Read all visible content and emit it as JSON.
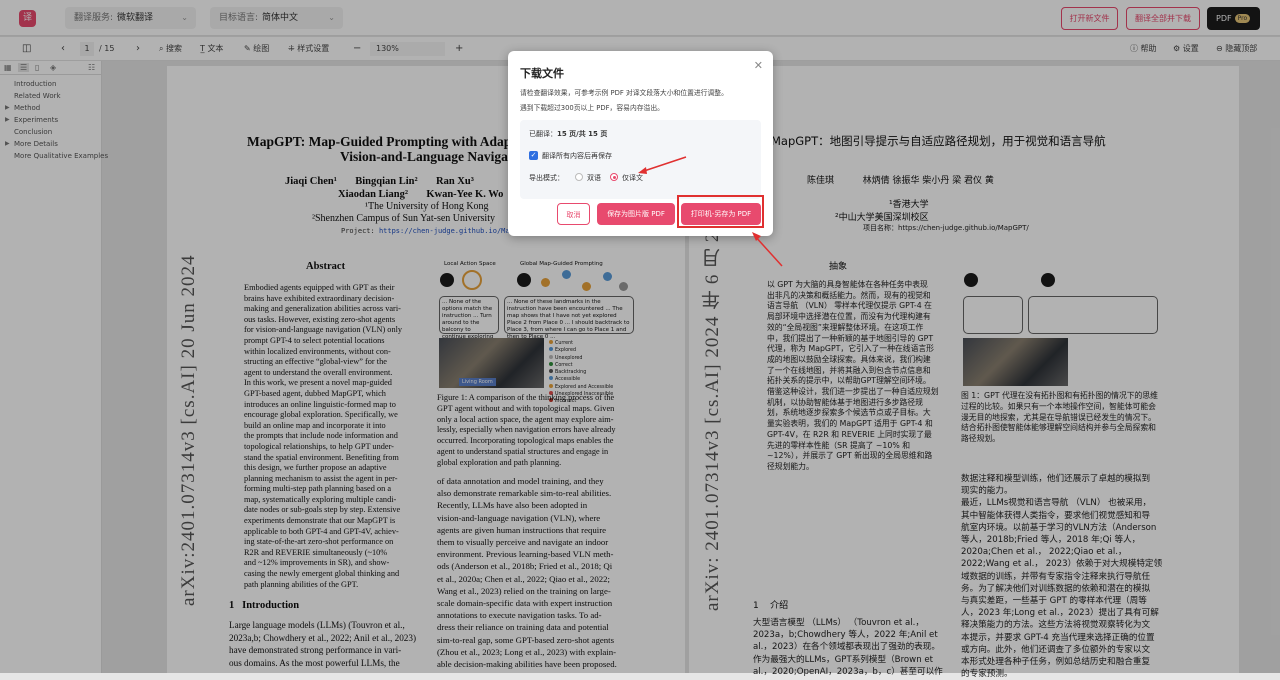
{
  "app": {
    "logo_text": "译"
  },
  "header": {
    "service_label": "翻译服务:",
    "service_value": "微软翻译",
    "target_label": "目标语言:",
    "target_value": "简体中文",
    "open_new": "打开新文件",
    "translate_all": "翻译全部并下载",
    "pdf_label": "PDF",
    "pro_badge": "Pro"
  },
  "toolbar": {
    "page_current": "1",
    "page_total": "/ 15",
    "search": "搜索",
    "text": "文本",
    "draw": "绘图",
    "style": "样式设置",
    "zoom": "130%",
    "help": "帮助",
    "settings": "设置",
    "hide_top": "隐藏顶部"
  },
  "outline": [
    "Introduction",
    "Related Work",
    "Method",
    "Experiments",
    "Conclusion",
    "More Details",
    "More Qualitative Examples"
  ],
  "paper": {
    "title1": "MapGPT: Map-Guided Prompting with Adaptiv",
    "title2": "Vision-and-Language Navigatio",
    "authors1": "Jiaqi Chen¹       Bingqian Lin²       Ran Xu³",
    "authors2": "Xiaodan Liang²       Kwan-Yee K. Wo",
    "affil1": "¹The University of Hong Kong",
    "affil2": "²Shenzhen Campus of Sun Yat-sen University",
    "project_label": "Project:",
    "project_url": "https://chen-judge.github.io/MapG",
    "arxiv": "arXiv:2401.07314v3  [cs.AI]  20 Jun 2024",
    "abstract_title": "Abstract",
    "abstract_lines": [
      "Embodied agents equipped with GPT as their",
      "brains have exhibited extraordinary decision-",
      "making and generalization abilities across vari-",
      "ous tasks. However, existing zero-shot agents",
      "for vision-and-language navigation (VLN) only",
      "prompt GPT-4 to select potential locations",
      "within localized environments, without con-",
      "structing an effective “global-view” for the",
      "agent to understand the overall environment.",
      "In this work, we present a novel map-guided",
      "GPT-based agent, dubbed MapGPT, which",
      "introduces an online linguistic-formed map to",
      "encourage global exploration. Specifically, we",
      "build an online map and incorporate it into",
      "the prompts that include node information and",
      "topological relationships, to help GPT under-",
      "stand the spatial environment. Benefiting from",
      "this design, we further propose an adaptive",
      "planning mechanism to assist the agent in per-",
      "forming multi-step path planning based on a",
      "map, systematically exploring multiple candi-",
      "date nodes or sub-goals step by step. Extensive",
      "experiments demonstrate that our MapGPT is",
      "applicable to both GPT-4 and GPT-4V, achiev-",
      "ing state-of-the-art zero-shot performance on",
      "R2R and REVERIE simultaneously (~10%",
      "and ~12% improvements in SR), and show-",
      "casing the newly emergent global thinking and",
      "path planning abilities of the GPT."
    ],
    "intro_title": "1   Introduction",
    "intro_lines": [
      "Large language models (LLMs) (Touvron et al.,",
      "2023a,b; Chowdhery et al., 2022; Anil et al., 2023)",
      "have demonstrated strong performance in vari-",
      "ous domains.  As the most powerful LLMs, the"
    ],
    "fig_local": "Local Action Space",
    "fig_global": "Global Map-Guided Prompting",
    "fig_bubble1": "... None of the options match the instruction ... Turn around to the balcony to continue exploring",
    "fig_bubble2": "... None of these landmarks in the instruction have been encountered ... The map shows that I have not yet explored Place 2 from Place 0 ... I should backtrack to Place 3, from where I can go to Place 1 and then to Place 0 ...",
    "fig_room": "Living Room",
    "legend": [
      "Current",
      "Explored",
      "Unexplored",
      "Correct",
      "Backtracking",
      "Accessible",
      "Explored and Accessible",
      "Unexplored Inaccessible",
      "Incorrect"
    ],
    "caption_lines": [
      "Figure 1: A comparison of the thinking process of the",
      "GPT agent without and with topological maps. Given",
      "only a local action space, the agent may explore aim-",
      "lessly, especially when navigation errors have already",
      "occurred. Incorporating topological maps enables the",
      "agent to understand spatial structures and engage in",
      "global exploration and path planning."
    ],
    "col2_lines": [
      "of data annotation and model training, and they",
      "also demonstrate remarkable sim-to-real abilities.",
      "   Recently, LLMs have also been adopted in",
      "vision-and-language navigation (VLN), where",
      "agents are given human instructions that require",
      "them to visually perceive and navigate an indoor",
      "environment. Previous learning-based VLN meth-",
      "ods (Anderson et al., 2018b; Fried et al., 2018; Qi",
      "et al., 2020a; Chen et al., 2022; Qiao et al., 2022;",
      "Wang et al., 2023) relied on the training on large-",
      "scale domain-specific data with expert instruction",
      "annotations to execute navigation tasks.  To ad-",
      "dress their reliance on training data and potential",
      "sim-to-real gap, some GPT-based zero-shot agents",
      "(Zhou et al., 2023; Long et al., 2023) with explain-",
      "able decision-making abilities have been proposed."
    ]
  },
  "translated": {
    "title": "MapGPT：地图引导提示与自适应路径规划，用于视觉和语言导航",
    "authors": "陈佳琪          林炳倩 徐振华 柴小丹 梁 君仪 黄",
    "affil1": "¹香港大学",
    "affil2": "²中山大学美国深圳校区",
    "project": "项目名称：https://chen-judge.github.io/MapGPT/",
    "arxiv": "arXiv: 2401.07314v3  [cs.AI]  2024 年 6 月 20 日",
    "abstract_title": "抽象",
    "abstract_lines": [
      "以 GPT 为大脑的具身智能体在各种任务中表现",
      "出非凡的决策和概括能力。然而，现有的视觉和",
      "语言导航 （VLN） 零样本代理仅提示 GPT-4 在",
      "局部环境中选择潜在位置，而没有为代理构建有",
      "效的“全局视图”来理解整体环境。在这项工作",
      "中，我们提出了一种新颖的基于地图引导的 GPT",
      "代理，称为 MapGPT，它引入了一种在线语言形",
      "成的地图以鼓励全球探索。具体来说，我们构建",
      "了一个在线地图，并将其融入到包含节点信息和",
      "拓扑关系的提示中，以帮助GPT理解空间环境。",
      "借鉴这种设计，我们进一步提出了一种自适应规划",
      "机制，以协助智能体基于地图进行多步路径规",
      "划，系统地逐步探索多个候选节点或子目标。大",
      "量实验表明，我们的 MapGPT 适用于 GPT-4 和",
      "GPT-4V，在 R2R 和 REVERIE 上同时实现了最",
      "先进的零样本性能（SR 提高了 ~10% 和",
      "~12%），并展示了 GPT 新出现的全局思维和路",
      "径规划能力。"
    ],
    "fig_caption_lines": [
      "图 1：GPT 代理在没有拓扑图和有拓扑图的情况下的思维",
      "过程的比较。如果只有一个本地操作空间，智能体可能会",
      "漫无目的地探索，尤其是在导航错误已经发生的情况下。",
      "结合拓扑图使智能体能够理解空间结构并参与全局探索和",
      "路径规划。"
    ],
    "col2_lines": [
      "数据注释和模型训练，他们还展示了卓越的模拟到",
      "现实的能力。",
      "最近，LLMs视觉和语言导航 （VLN） 也被采用，",
      "其中智能体获得人类指令，要求他们视觉感知和导",
      "航室内环境。以前基于学习的VLN方法（Anderson",
      "等人，2018b;Fried 等人，2018 年;Qi 等人，",
      "2020a;Chen et al.，  2022;Qiao et al.，",
      "2022;Wang et al.，  2023）依赖于对大规模特定领",
      "域数据的训练，并带有专家指令注释来执行导航任",
      "务。为了解决他们对训练数据的依赖和潜在的模拟",
      "与真实差距，一些基于 GPT 的零样本代理（周等",
      "人，2023 年;Long et al.，2023）提出了具有可解",
      "释决策能力的方法。这些方法将视觉观察转化为文",
      "本提示，并要求 GPT-4 充当代理来选择正确的位置",
      "或方向。此外，他们还调查了多位额外的专家以文",
      "本形式处理各种子任务，例如总结历史和融合重复",
      "的专家预测。"
    ],
    "intro_title": "1    介绍",
    "intro_lines": [
      "大型语言模型 （LLMs） （Touvron et al.，",
      "2023a，b;Chowdhery 等人，2022 年;Anil et",
      "al.，2023）在各个领域都表现出了强劲的表现。",
      "作为最强大的LLMs，GPT系列模型（Brown et",
      "al.，2020;OpenAI，2023a，b，c）甚至可以作"
    ]
  },
  "modal": {
    "title": "下载文件",
    "desc1": "请检查翻译效果，可参考示例 PDF 对译文段落大小和位置进行调整。",
    "desc2": "遇到下载超过300页以上 PDF，容易内存溢出。",
    "translated_label": "已翻译：",
    "translated_value": "15 页/共 15 页",
    "checkbox_label": "翻译所有内容后再保存",
    "mode_label": "导出模式：",
    "mode_bilingual": "双语",
    "mode_translated_only": "仅译文",
    "cancel": "取消",
    "save_image_pdf": "保存为图片版 PDF",
    "print_pdf": "打印机-另存为 PDF"
  },
  "colors": {
    "accent": "#e84a6e",
    "annotation": "#e03030"
  }
}
